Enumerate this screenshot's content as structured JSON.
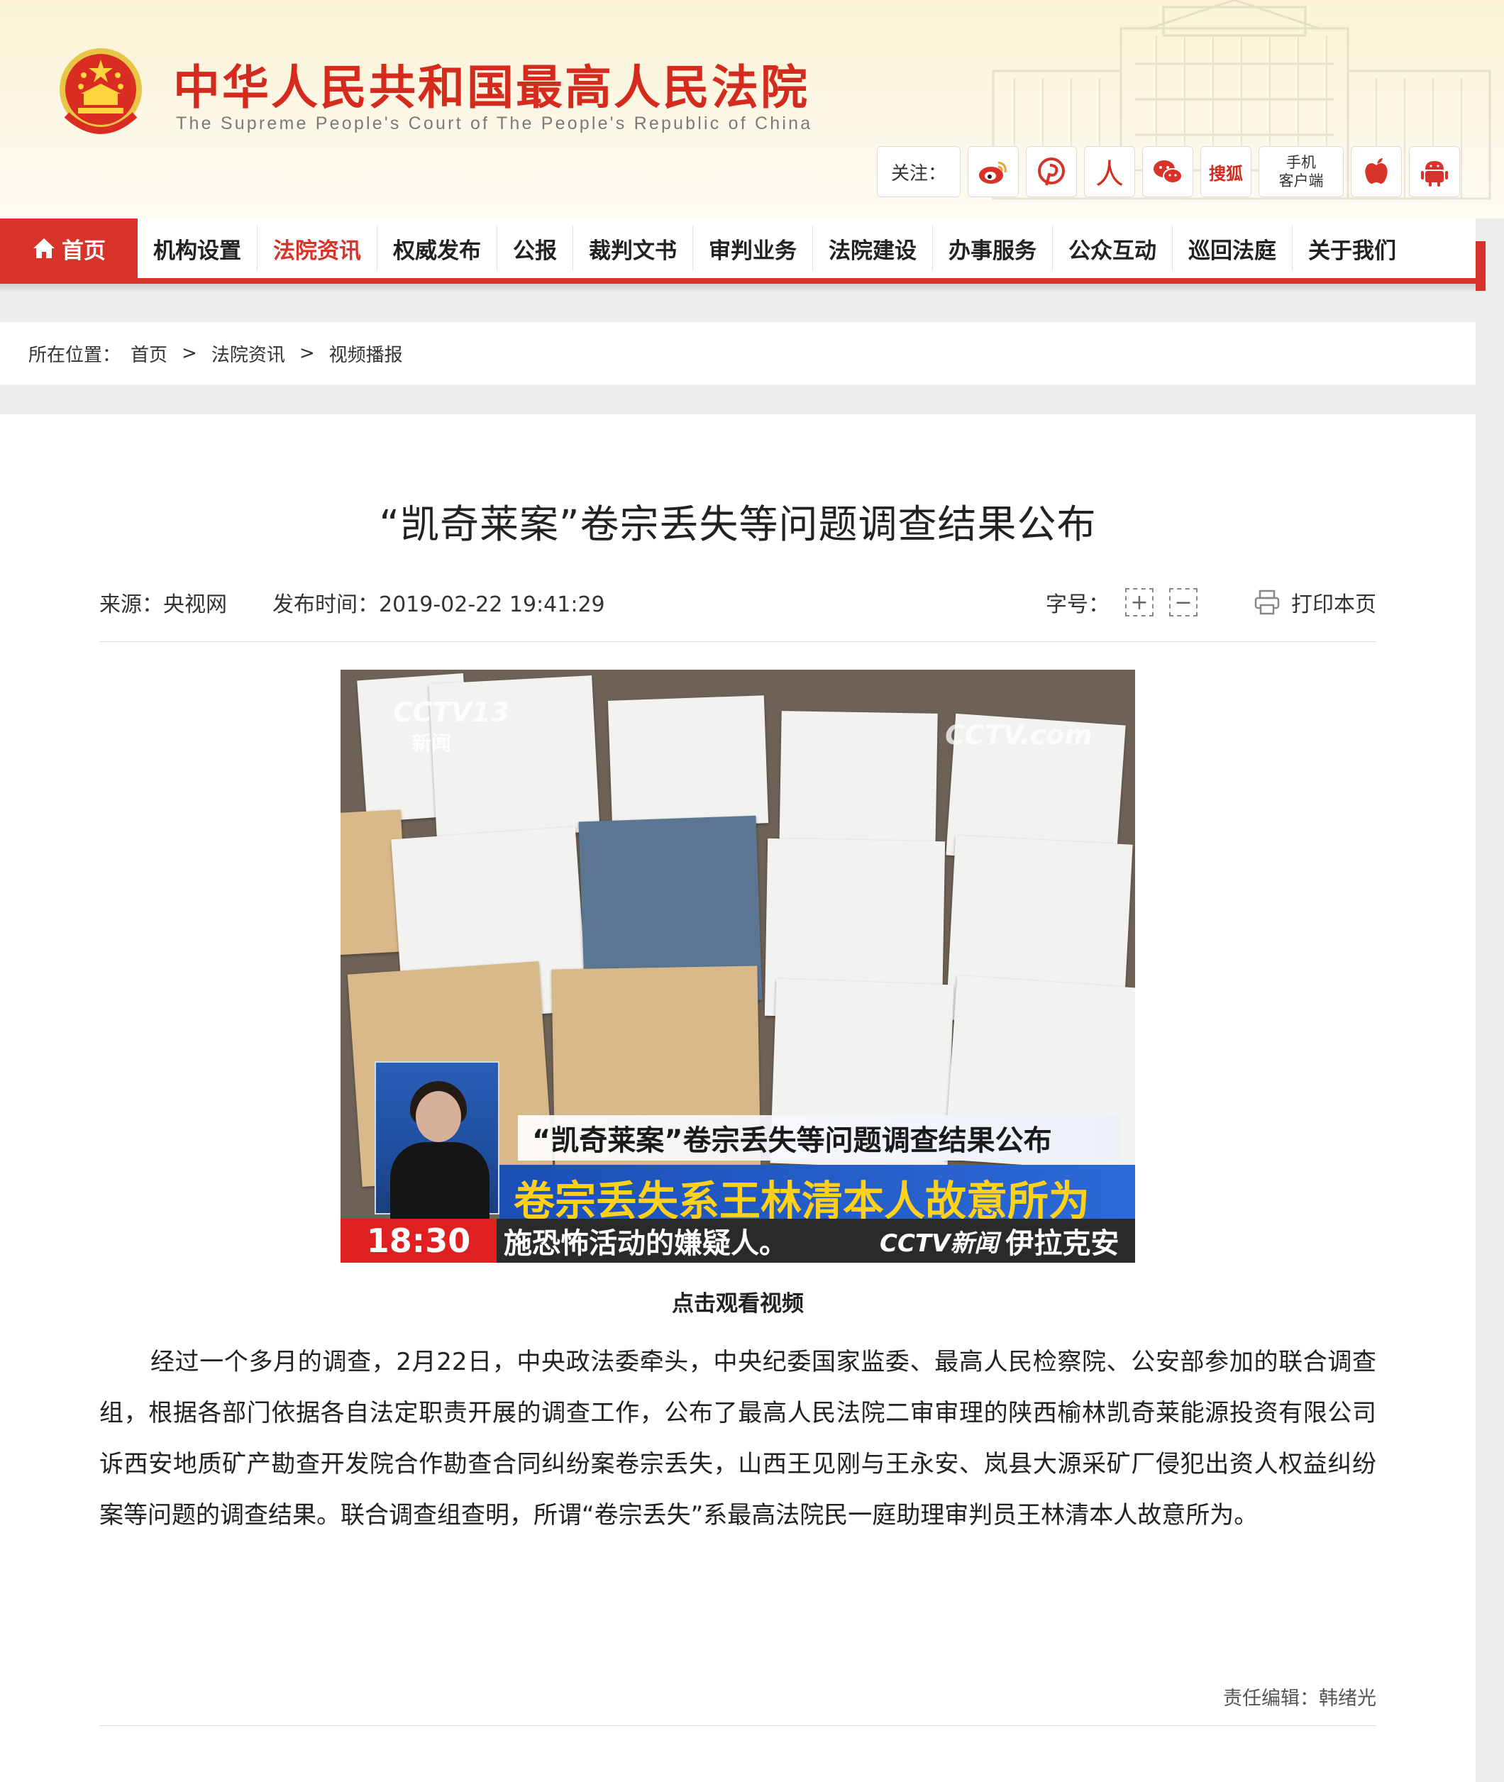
{
  "header": {
    "site_title": "中华人民共和国最高人民法院",
    "site_subtitle": "The Supreme People's Court of The People's Republic of China",
    "follow_label": "关注：",
    "social": [
      {
        "name": "weibo-icon"
      },
      {
        "name": "pinterest-icon"
      },
      {
        "name": "people-icon",
        "glyph": "人"
      },
      {
        "name": "wechat-icon"
      },
      {
        "name": "sohu-icon",
        "glyph": "搜狐"
      },
      {
        "name": "mobile-client",
        "line1": "手机",
        "line2": "客户端"
      },
      {
        "name": "apple-icon"
      },
      {
        "name": "android-icon"
      }
    ]
  },
  "nav": {
    "items": [
      "首页",
      "机构设置",
      "法院资讯",
      "权威发布",
      "公报",
      "裁判文书",
      "审判业务",
      "法院建设",
      "办事服务",
      "公众互动",
      "巡回法庭",
      "关于我们"
    ],
    "active": "法院资讯"
  },
  "breadcrumb": {
    "label": "所在位置：",
    "items": [
      "首页",
      "法院资讯",
      "视频播报"
    ],
    "sep": ">"
  },
  "article": {
    "title": "“凯奇莱案”卷宗丢失等问题调查结果公布",
    "source_label": "来源：",
    "source": "央视网",
    "time_label": "发布时间：",
    "time": "2019-02-22 19:41:29",
    "font_label": "字号：",
    "font_plus": "+",
    "font_minus": "−",
    "print_label": "打印本页",
    "video": {
      "logo": "CCTV13",
      "logo_sub": "新闻",
      "watermark": "CCTV.com",
      "caption_top": "“凯奇莱案”卷宗丢失等问题调查结果公布",
      "caption_main": "卷宗丢失系王林清本人故意所为",
      "time": "18:30",
      "ticker": "施恐怖活动的嫌疑人。",
      "ticker_logo": "CCTV新闻",
      "ticker2": "伊拉克安"
    },
    "video_caption": "点击观看视频",
    "body": "经过一个多月的调查，2月22日，中央政法委牵头，中央纪委国家监委、最高人民检察院、公安部参加的联合调查组，根据各部门依据各自法定职责开展的调查工作，公布了最高人民法院二审审理的陕西榆林凯奇莱能源投资有限公司诉西安地质矿产勘查开发院合作勘查合同纠纷案卷宗丢失，山西王见刚与王永安、岚县大源采矿厂侵犯出资人权益纠纷案等问题的调查结果。联合调查组查明，所谓“卷宗丢失”系最高法院民一庭助理审判员王林清本人故意所为。",
    "editor": "责任编辑：韩绪光"
  },
  "colors": {
    "brand_red": "#d8332a",
    "title_red": "#d52b1e"
  }
}
